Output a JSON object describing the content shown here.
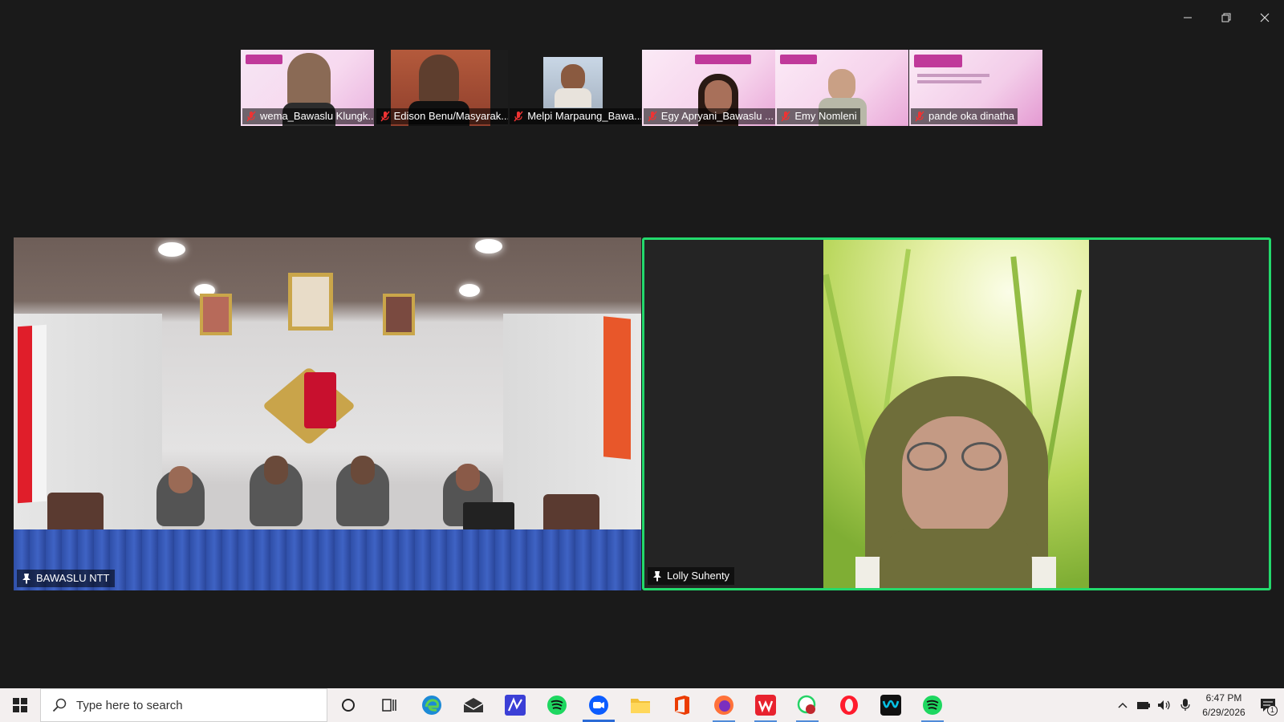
{
  "window": {
    "controls": [
      "minimize",
      "restore",
      "close"
    ]
  },
  "participants_strip": [
    {
      "name": "wema_Bawaslu Klungk...",
      "muted": true
    },
    {
      "name": "Edison Benu/Masyarak...",
      "muted": true
    },
    {
      "name": "Melpi Marpaung_Bawa...",
      "muted": true
    },
    {
      "name": "Egy Apryani_Bawaslu ...",
      "muted": true
    },
    {
      "name": "Emy Nomleni",
      "muted": true
    },
    {
      "name": "pande oka dinatha",
      "muted": true
    }
  ],
  "main_tiles": [
    {
      "name": "BAWASLU NTT",
      "pinned": true
    },
    {
      "name": "Lolly Suhenty",
      "pinned": true,
      "active_speaker": true
    }
  ],
  "taskbar": {
    "search_placeholder": "Type here to search",
    "apps": [
      "cortana",
      "task-view",
      "edge",
      "mail",
      "app-m",
      "spotify",
      "zoom",
      "file-explorer",
      "office",
      "firefox",
      "wps",
      "whatsapp",
      "opera",
      "webex",
      "spotify"
    ],
    "time": "6:47 PM",
    "date": "6/29/2026",
    "notification_count": "1"
  }
}
